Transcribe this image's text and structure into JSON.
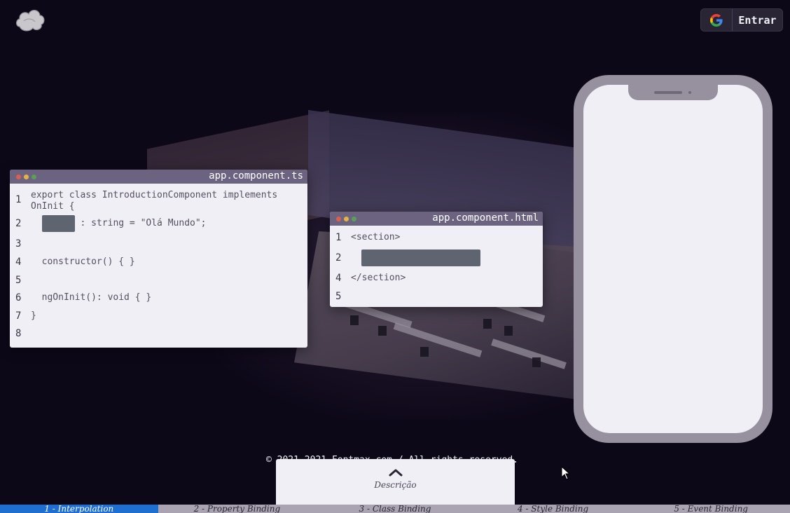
{
  "header": {
    "login_label": "Entrar",
    "google_icon": "google-icon",
    "logo_icon": "cloud-logo-icon"
  },
  "ts_window": {
    "filename": "app.component.ts",
    "lines": [
      {
        "num": "1",
        "before": "export class IntroductionComponent implements\nOnInit {",
        "after": ""
      },
      {
        "num": "2",
        "before": "  ",
        "after": " : string = \"Olá Mundo\";"
      },
      {
        "num": "3",
        "before": "",
        "after": ""
      },
      {
        "num": "4",
        "before": "  constructor() { }",
        "after": ""
      },
      {
        "num": "5",
        "before": "",
        "after": ""
      },
      {
        "num": "6",
        "before": "  ngOnInit(): void { }",
        "after": ""
      },
      {
        "num": "7",
        "before": "}",
        "after": ""
      },
      {
        "num": "8",
        "before": "",
        "after": ""
      }
    ]
  },
  "html_window": {
    "filename": "app.component.html",
    "lines": [
      {
        "num": "1",
        "text": "<section>"
      },
      {
        "num": "2",
        "text": ""
      },
      {
        "num": "4",
        "text": "</section>"
      },
      {
        "num": "5",
        "text": ""
      }
    ]
  },
  "footer": {
    "copyright": "© 2021-2021 Fontmax.com / All rights reserved.",
    "description_label": "Descrição"
  },
  "tabs": [
    {
      "label": "1 - Interpolation",
      "active": true
    },
    {
      "label": "2 - Property Binding",
      "active": false
    },
    {
      "label": "3 - Class Binding",
      "active": false
    },
    {
      "label": "4 - Style Binding",
      "active": false
    },
    {
      "label": "5 - Event Binding",
      "active": false
    }
  ],
  "colors": {
    "background": "#0d0818",
    "titlebar": "#6c6380",
    "active_tab": "#1e6fd0",
    "phone_frame": "#97909f"
  }
}
